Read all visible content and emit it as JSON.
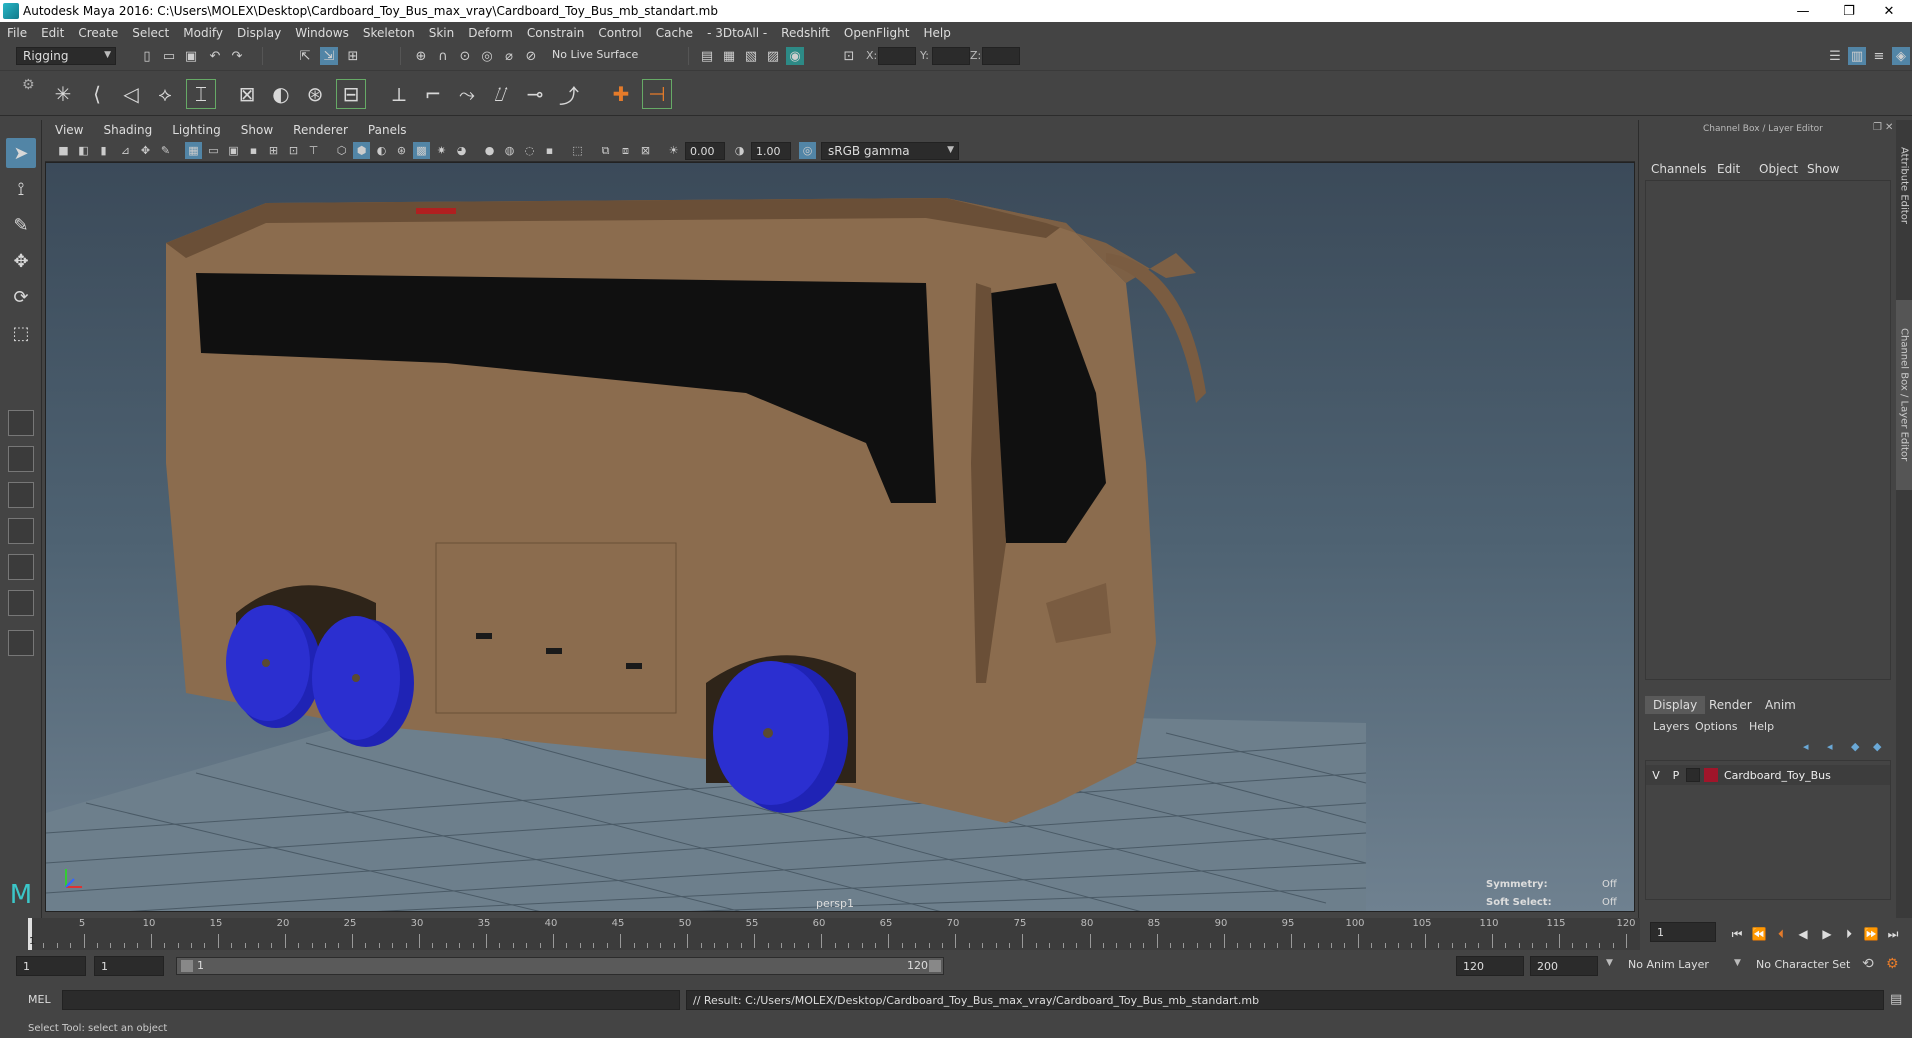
{
  "window": {
    "title": "Autodesk Maya 2016: C:\\Users\\MOLEX\\Desktop\\Cardboard_Toy_Bus_max_vray\\Cardboard_Toy_Bus_mb_standart.mb",
    "minimize": "—",
    "restore": "❐",
    "close": "✕"
  },
  "menubar": [
    "File",
    "Edit",
    "Create",
    "Select",
    "Modify",
    "Display",
    "Windows",
    "Skeleton",
    "Skin",
    "Deform",
    "Constrain",
    "Control",
    "Cache",
    "- 3DtoAll -",
    "Redshift",
    "OpenFlight",
    "Help"
  ],
  "statusline": {
    "menuset": "Rigging",
    "live_surface": "No Live Surface",
    "x_label": "X:",
    "y_label": "Y:",
    "z_label": "Z:"
  },
  "panel": {
    "menus": [
      "View",
      "Shading",
      "Lighting",
      "Show",
      "Renderer",
      "Panels"
    ],
    "near_value": "0.00",
    "far_value": "1.00",
    "color_space": "sRGB gamma",
    "camera_name": "persp1",
    "symmetry_label": "Symmetry:",
    "symmetry_value": "Off",
    "soft_select_label": "Soft Select:",
    "soft_select_value": "Off"
  },
  "right_panel": {
    "title": "Channel Box / Layer Editor",
    "channel_menus": [
      "Channels",
      "Edit",
      "Object",
      "Show"
    ],
    "layer_tabs": [
      "Display",
      "Render",
      "Anim"
    ],
    "layer_menus": [
      "Layers",
      "Options",
      "Help"
    ],
    "layer": {
      "visible": "V",
      "playback": "P",
      "name": "Cardboard_Toy_Bus",
      "color": "#a0152a"
    },
    "side_tabs": [
      "Attribute Editor",
      "Channel Box / Layer Editor"
    ]
  },
  "timeline": {
    "ticks": [
      "5",
      "10",
      "15",
      "20",
      "25",
      "30",
      "35",
      "40",
      "45",
      "50",
      "55",
      "60",
      "65",
      "70",
      "75",
      "80",
      "85",
      "90",
      "95",
      "100",
      "105",
      "110",
      "115",
      "120"
    ],
    "first_frame": "1",
    "current_frame": "1"
  },
  "range": {
    "start_field": "1",
    "playback_start": "1",
    "range_start_label": "1",
    "range_end_label": "120",
    "playback_end": "120",
    "end_field": "200",
    "anim_layer": "No Anim Layer",
    "character_set": "No Character Set"
  },
  "command": {
    "mode": "MEL",
    "result": "// Result: C:/Users/MOLEX/Desktop/Cardboard_Toy_Bus_max_vray/Cardboard_Toy_Bus_mb_standart.mb"
  },
  "help_line": "Select Tool: select an object",
  "colors": {
    "accent": "#5285a6",
    "cardboard": "#8b6c4e",
    "wheel": "#2b2fd0"
  }
}
